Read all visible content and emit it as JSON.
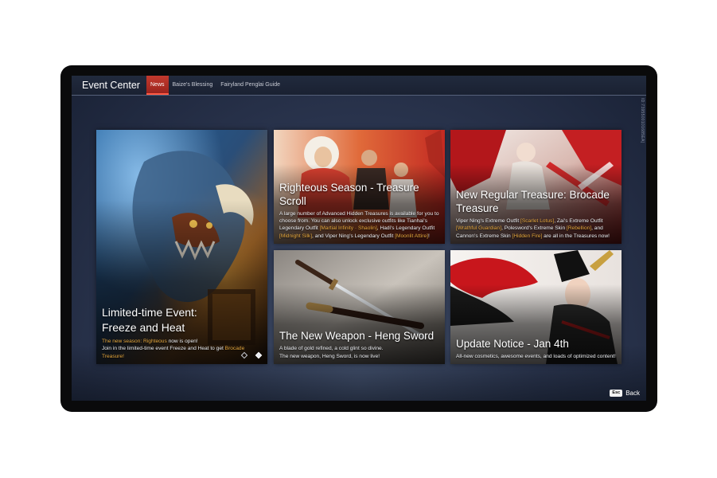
{
  "app": {
    "title": "Event Center"
  },
  "tabs": [
    {
      "label": "News",
      "active": true
    },
    {
      "label": "Baize's Blessing",
      "active": false
    },
    {
      "label": "Fairyland Penglai Guide",
      "active": false
    }
  ],
  "side_id": "ID:7395500101685EA]",
  "cards": [
    {
      "title_line1": "Limited-time Event:",
      "title_line2": "Freeze and Heat",
      "desc_hl1": "The new season: Righteous",
      "desc_t1": " now is open!",
      "desc_t2": "Join in the limited-time event Freeze and Heat to get ",
      "desc_hl2": "Brocade Treasure!"
    },
    {
      "title": "Righteous Season - Treasure Scroll",
      "desc_t1": "A large number of Advanced Hidden Treasures is available for you to choose from. You can also unlock exclusive outfits like Tianhai's Legendary Outfit ",
      "desc_hl1": "[Martial Infinity · Shaolin]",
      "desc_t2": ", Hadi's Legendary Outfit ",
      "desc_hl2": "[Midnight Silk]",
      "desc_t3": ", and Viper Ning's Legendary Outfit ",
      "desc_hl3": "[Moonlit Attire]",
      "desc_t4": "!"
    },
    {
      "title": "New Regular Treasure: Brocade Treasure",
      "desc_t1": "Viper Ning's Extreme Outfit ",
      "desc_hl1": "[Scarlet Lotus]",
      "desc_t2": ", Zai's Extreme Outfit ",
      "desc_hl2": "[Wrathful Guardian]",
      "desc_t3": ", Polesword's Extreme Skin ",
      "desc_hl3": "[Rebellion]",
      "desc_t4": ", and Cannon's Extreme Skin ",
      "desc_hl4": "[Hidden Fire]",
      "desc_t5": " are all in the Treasures now!"
    },
    {
      "title": "The New Weapon - Heng Sword",
      "desc_line1": "A blade of gold refined, a cold glint so divine.",
      "desc_line2": "The new weapon, Heng Sword, is now live!"
    },
    {
      "title": "Update Notice - Jan 4th",
      "desc": "All-new cosmetics, awesome events, and loads of optimized content!"
    }
  ],
  "carousel": {
    "count": 2,
    "active_index": 1
  },
  "back": {
    "key": "Esc",
    "label": "Back"
  },
  "colors": {
    "highlight": "#e6a83e",
    "active_tab": "#b52e25",
    "screen_bg": "#2f3a55"
  }
}
